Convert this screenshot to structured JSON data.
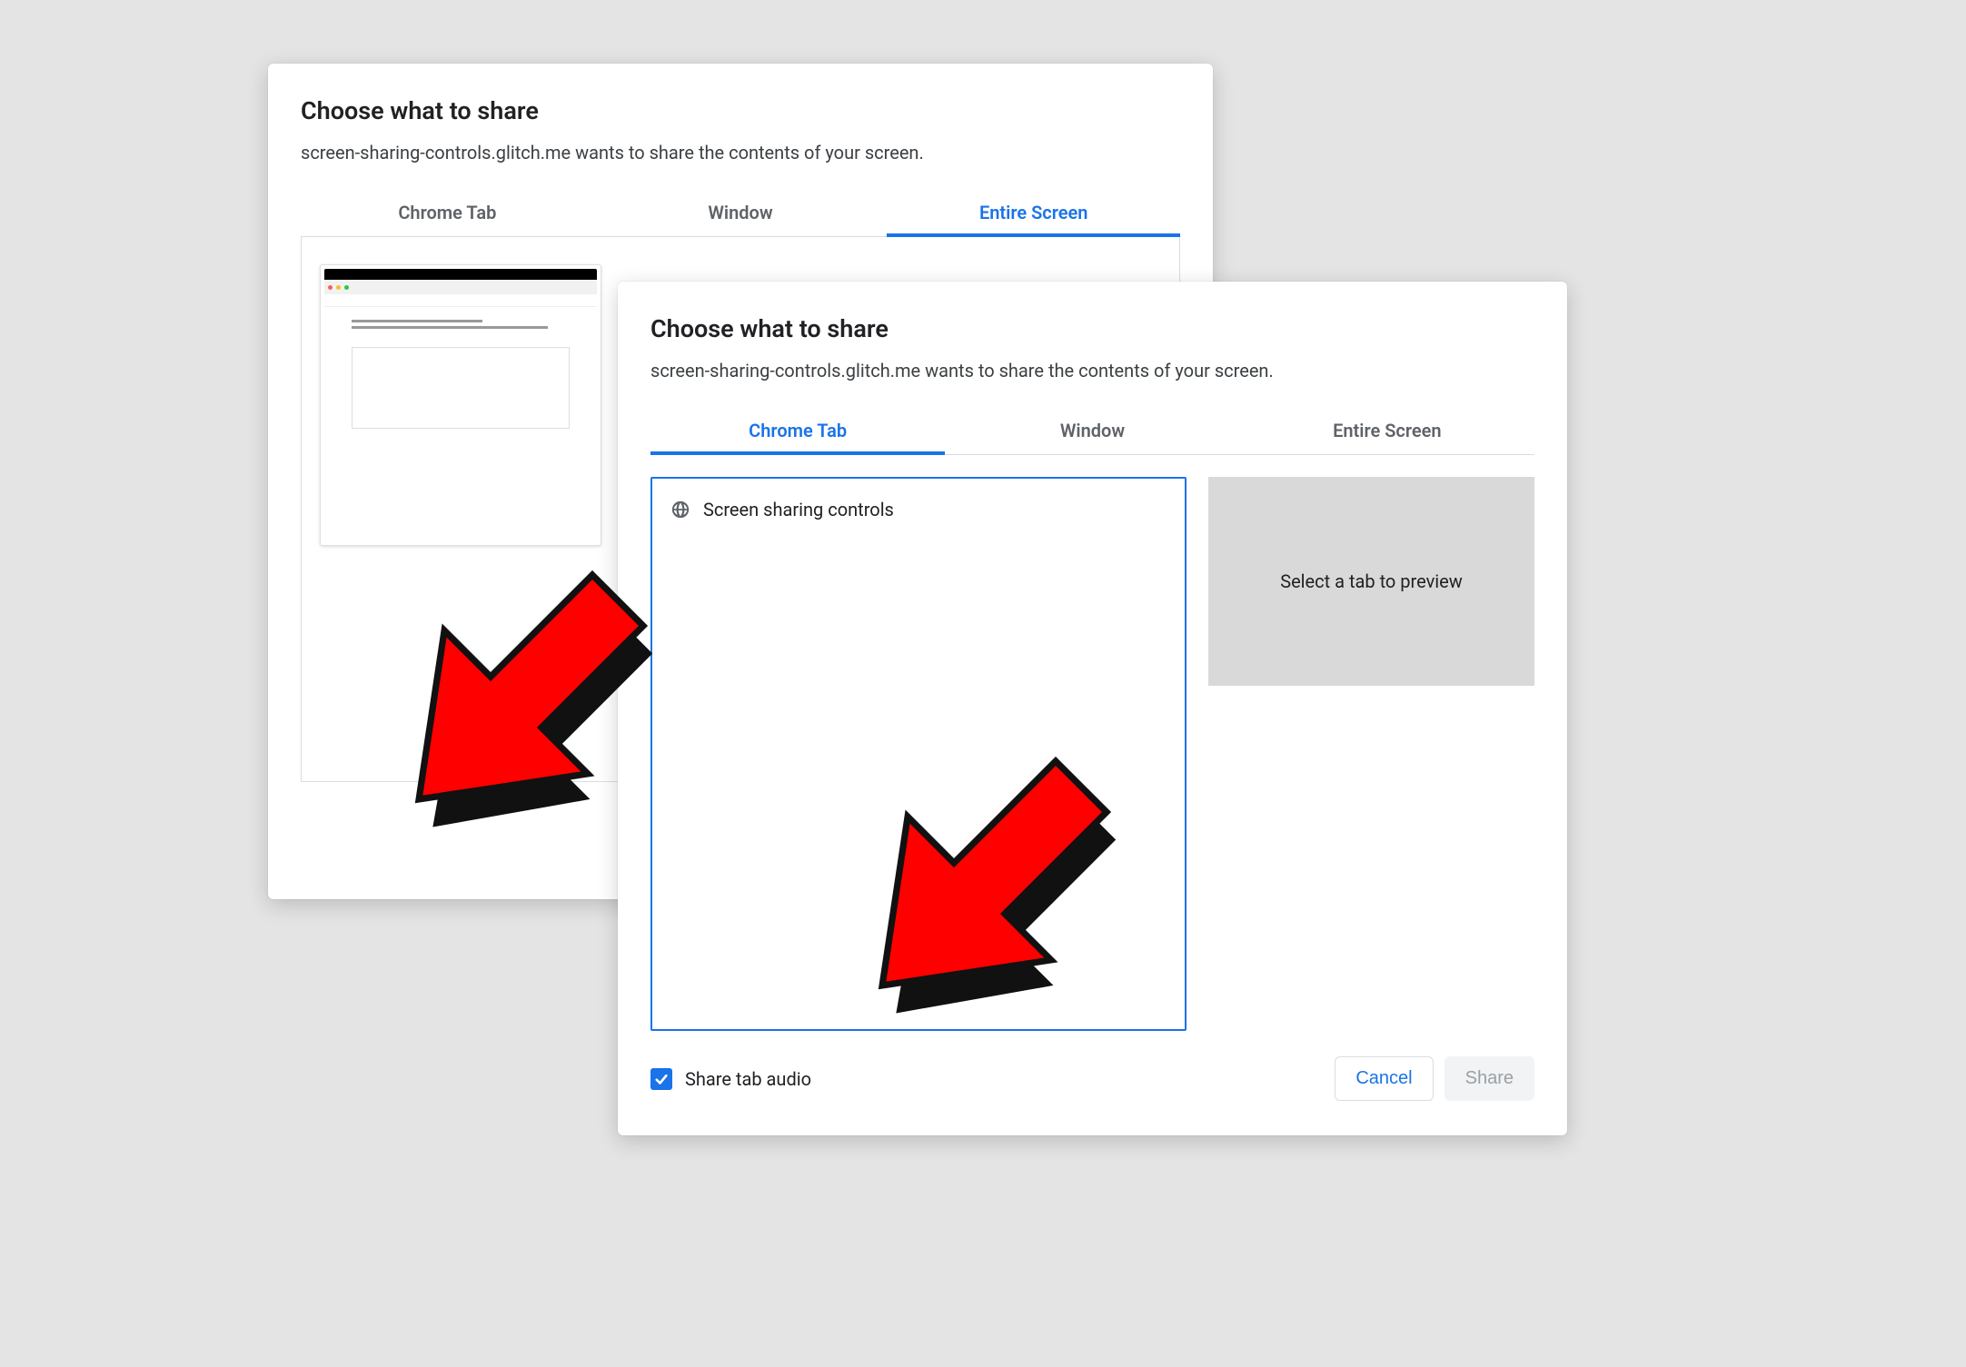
{
  "back": {
    "title": "Choose what to share",
    "subtitle": "screen-sharing-controls.glitch.me wants to share the contents of your screen.",
    "tabs": [
      "Chrome Tab",
      "Window",
      "Entire Screen"
    ],
    "active_tab_index": 2
  },
  "front": {
    "title": "Choose what to share",
    "subtitle": "screen-sharing-controls.glitch.me wants to share the contents of your screen.",
    "tabs": [
      "Chrome Tab",
      "Window",
      "Entire Screen"
    ],
    "active_tab_index": 0,
    "tab_list_items": [
      {
        "label": "Screen sharing controls"
      }
    ],
    "preview_placeholder": "Select a tab to preview",
    "share_audio_label": "Share tab audio",
    "share_audio_checked": true,
    "cancel_label": "Cancel",
    "share_label": "Share",
    "share_enabled": false
  },
  "colors": {
    "accent": "#1a73e8"
  }
}
